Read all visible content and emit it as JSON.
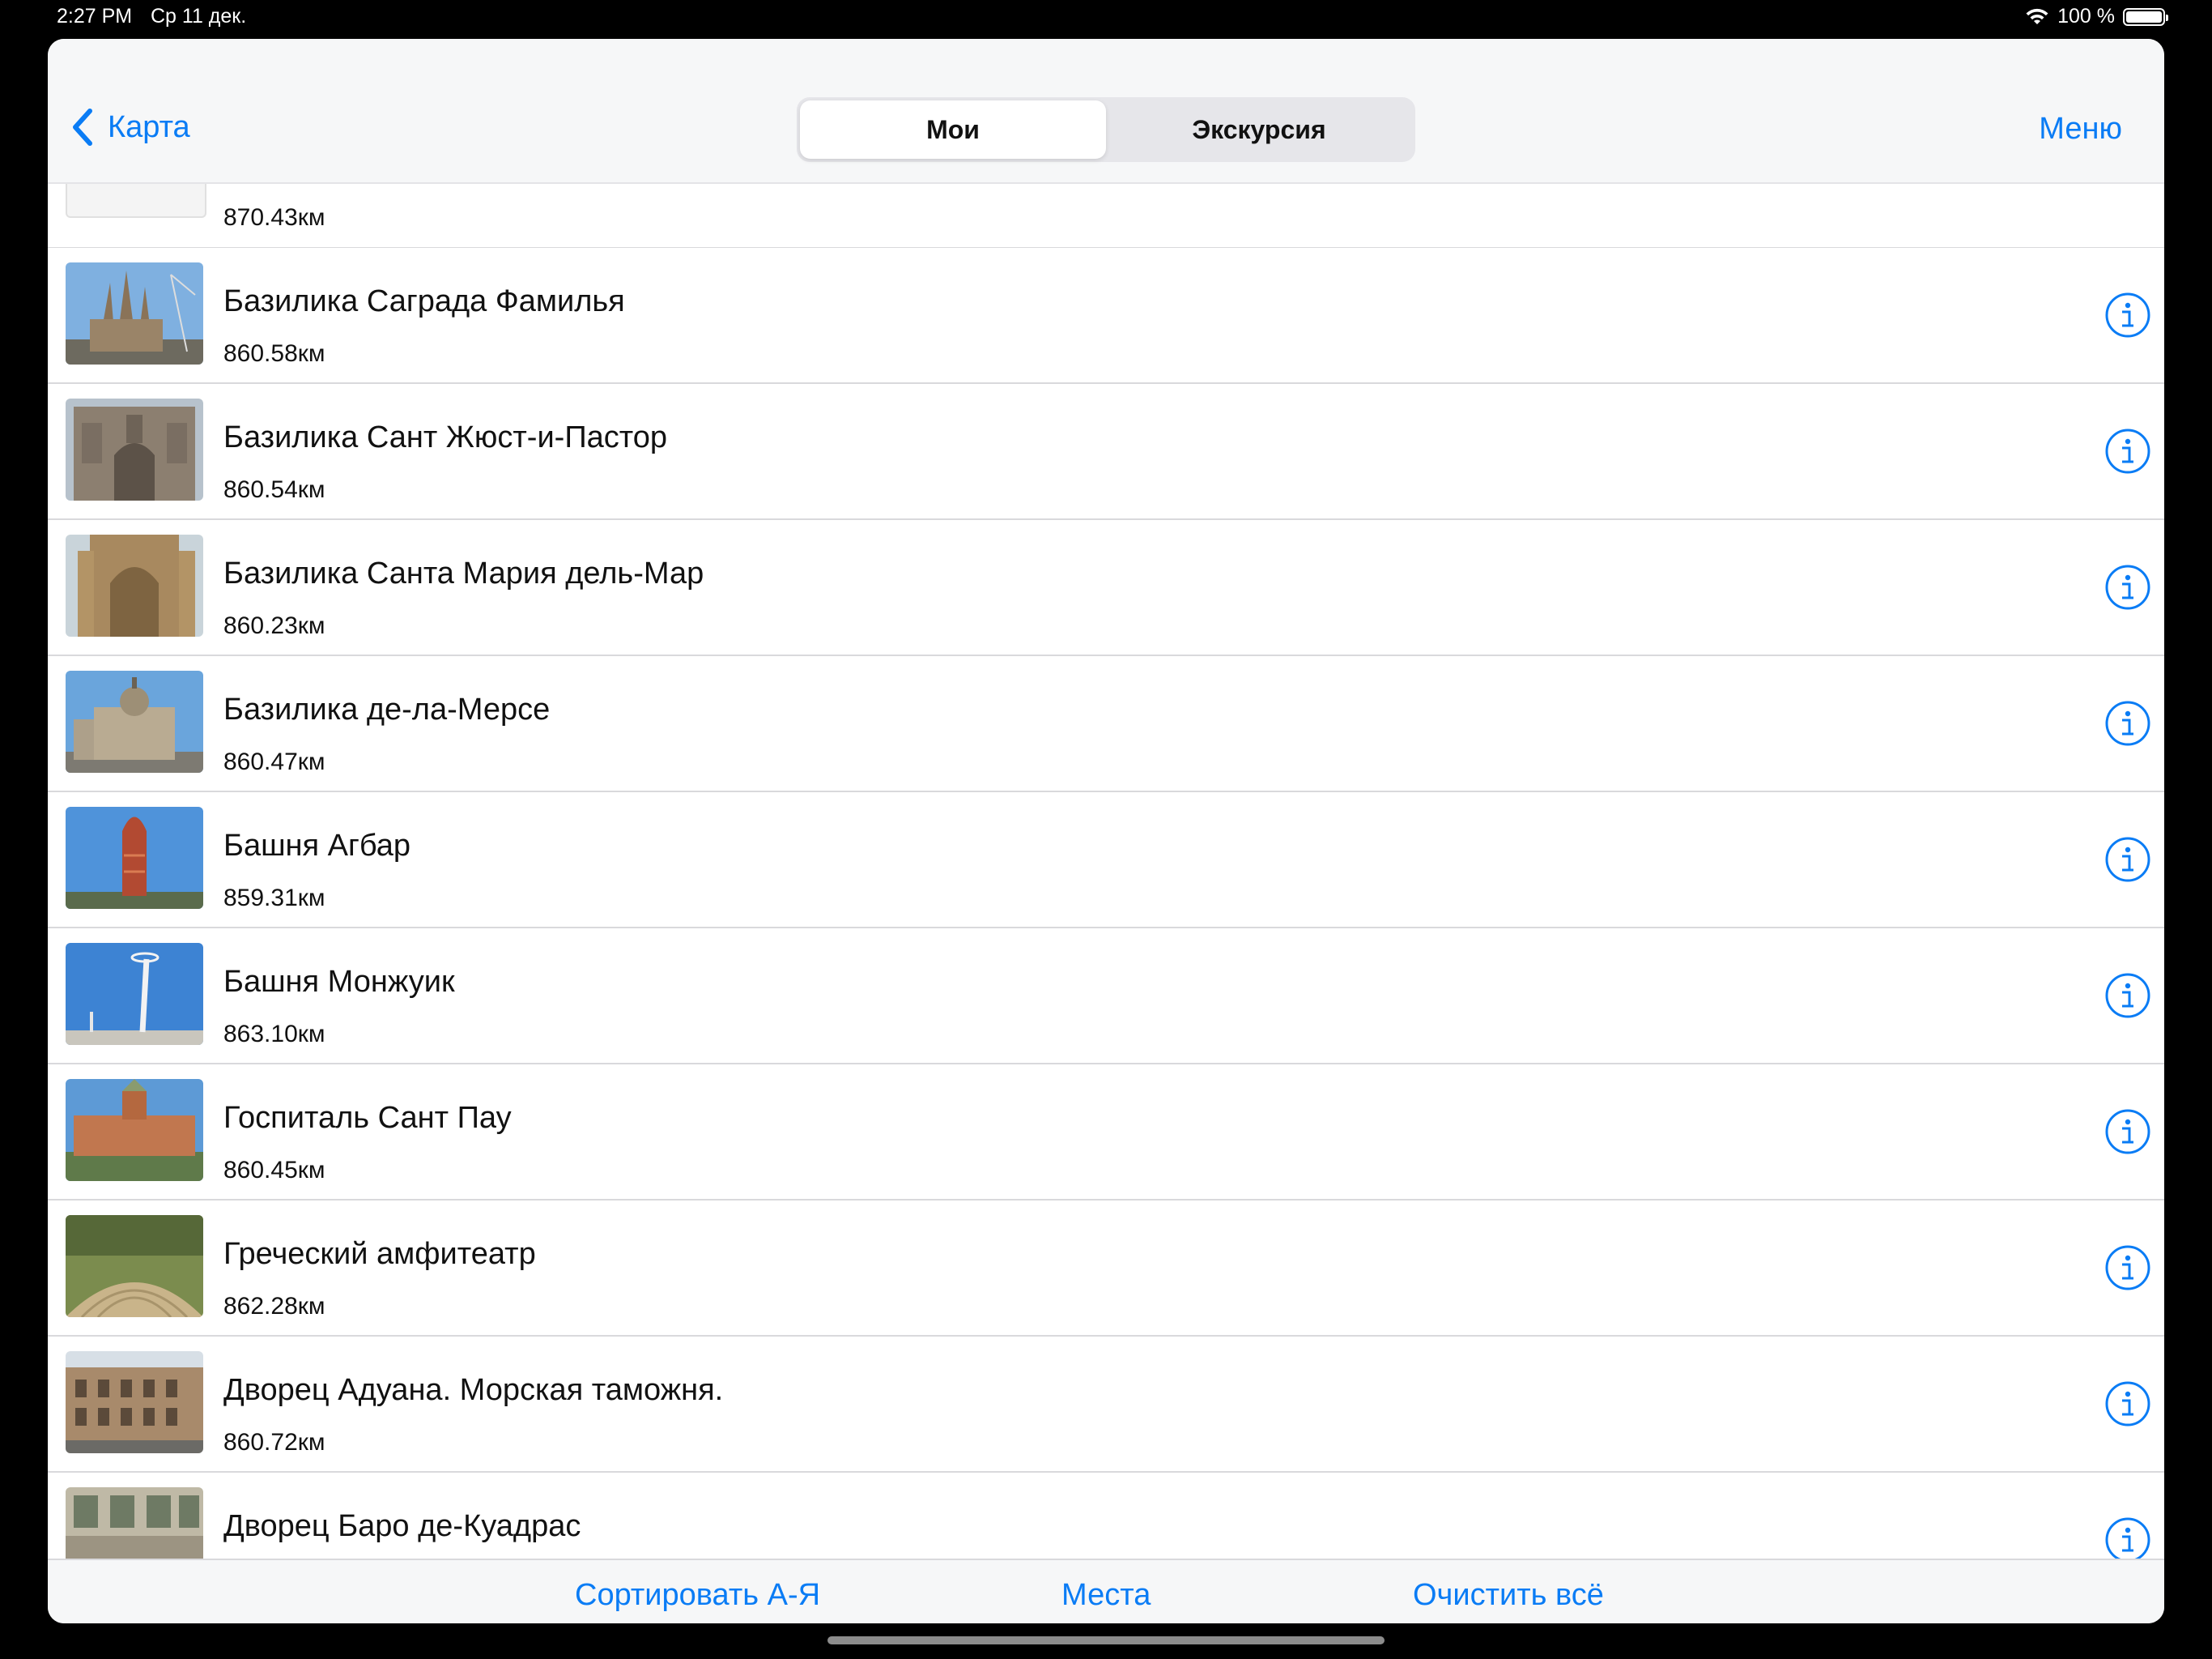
{
  "status_bar": {
    "time": "2:27 PM",
    "date": "Ср 11 дек.",
    "battery": "100 %"
  },
  "navbar": {
    "back_label": "Карта",
    "menu_label": "Меню",
    "segments": [
      "Мои",
      "Экскурсия"
    ],
    "selected_segment": "Мои"
  },
  "partial_row": {
    "distance": "870.43км"
  },
  "places": [
    {
      "title": "Базилика Саграда Фамилья",
      "distance": "860.58км",
      "thumb": "cathedral"
    },
    {
      "title": "Базилика Сант Жюст-и-Пастор",
      "distance": "860.54км",
      "thumb": "gothic"
    },
    {
      "title": "Базилика Санта Мария дель-Мар",
      "distance": "860.23км",
      "thumb": "church"
    },
    {
      "title": "Базилика де-ла-Мерсе",
      "distance": "860.47км",
      "thumb": "dome"
    },
    {
      "title": "Башня Агбар",
      "distance": "859.31км",
      "thumb": "tower"
    },
    {
      "title": "Башня Монжуик",
      "distance": "863.10км",
      "thumb": "commtower"
    },
    {
      "title": "Госпиталь Сант Пау",
      "distance": "860.45км",
      "thumb": "hospital"
    },
    {
      "title": "Греческий амфитеатр",
      "distance": "862.28км",
      "thumb": "amphitheatre"
    },
    {
      "title": "Дворец Адуана. Морская таможня.",
      "distance": "860.72км",
      "thumb": "palace"
    },
    {
      "title": "Дворец Баро де-Куадрас",
      "distance": "",
      "thumb": "facade"
    }
  ],
  "toolbar": {
    "sort_label": "Сортировать А-Я",
    "places_label": "Места",
    "clear_label": "Очистить всё"
  },
  "colors": {
    "accent": "#0a7cf5",
    "separator": "#d9d9dc",
    "bar_background": "#f6f7f8"
  }
}
